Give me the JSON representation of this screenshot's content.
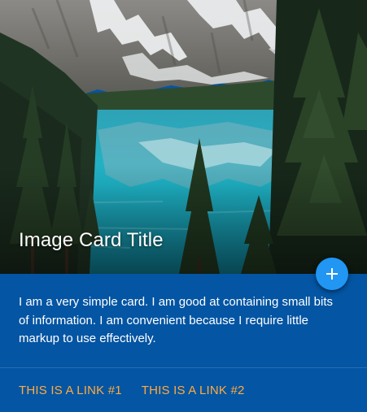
{
  "card": {
    "title": "Image Card Title",
    "text": "I am a very simple card. I am good at containing small bits of information. I am convenient because I require little markup to use effectively.",
    "image_icon": "mountain-lake-photo",
    "fab_icon": "plus-icon",
    "links": [
      {
        "label": "This is a link #1"
      },
      {
        "label": "This is a link #2"
      }
    ]
  },
  "colors": {
    "card_background": "#0455a3",
    "fab_background": "#2196f3",
    "link_color": "#ffab40",
    "text_color": "#ffffff"
  }
}
